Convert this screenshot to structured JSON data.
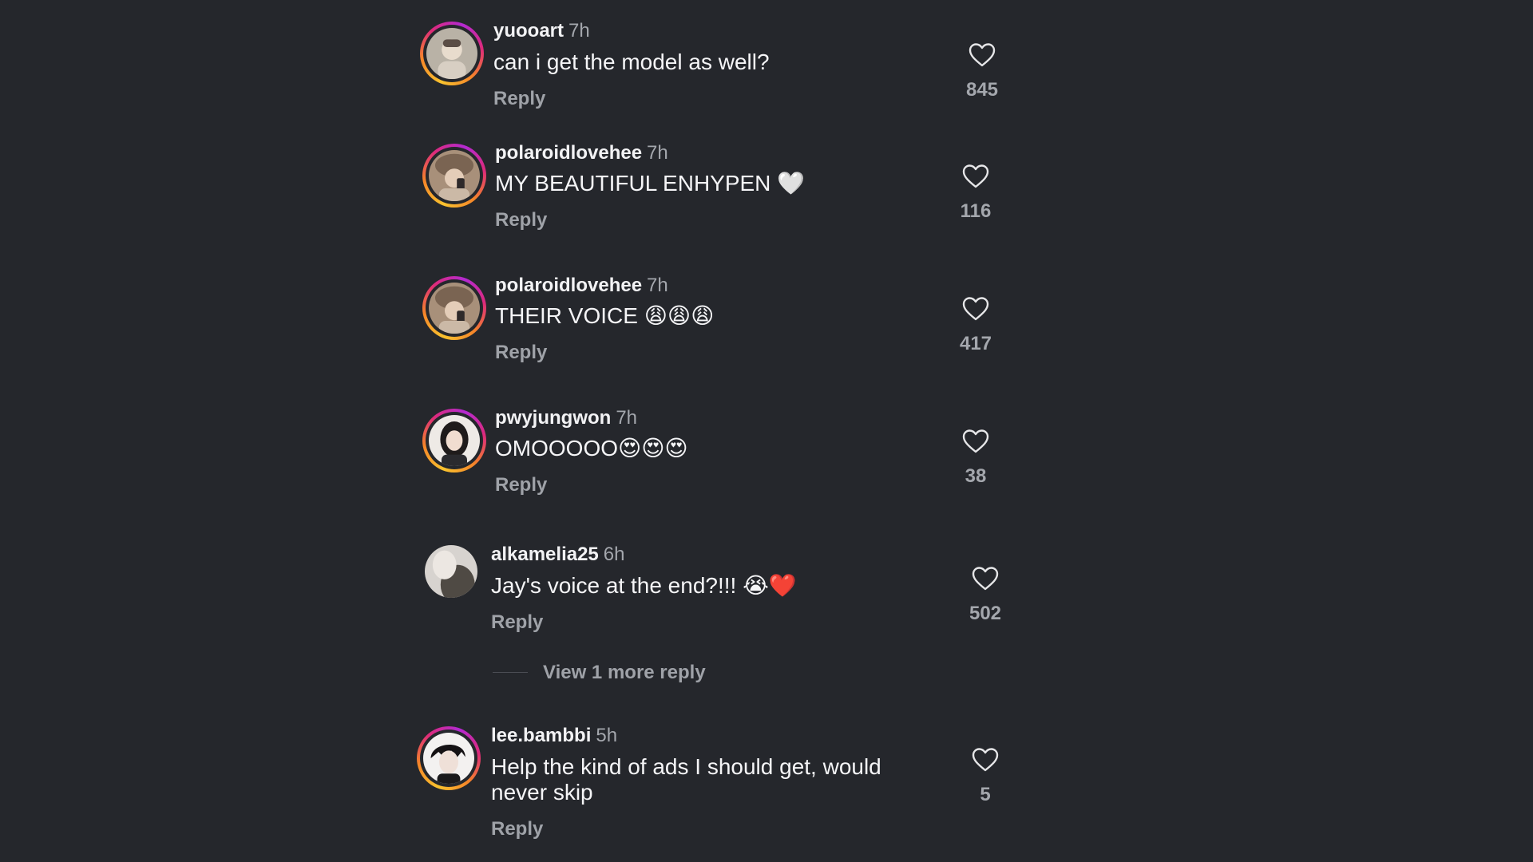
{
  "comments": [
    {
      "username": "yuooart",
      "time": "7h",
      "text": "can i get the model as well?",
      "reply_label": "Reply",
      "likes": "845",
      "avatar_story_ring": true
    },
    {
      "username": "polaroidlovehee",
      "time": "7h",
      "text": "MY BEAUTIFUL ENHYPEN 🤍",
      "reply_label": "Reply",
      "likes": "116",
      "avatar_story_ring": true
    },
    {
      "username": "polaroidlovehee",
      "time": "7h",
      "text": "THEIR VOICE 😩😩😩",
      "reply_label": "Reply",
      "likes": "417",
      "avatar_story_ring": true
    },
    {
      "username": "pwyjungwon",
      "time": "7h",
      "text": "OMOOOOO😍😍😍",
      "reply_label": "Reply",
      "likes": "38",
      "avatar_story_ring": true
    },
    {
      "username": "alkamelia25",
      "time": "6h",
      "text": "Jay's voice at the end?!!! 😭❤️",
      "reply_label": "Reply",
      "likes": "502",
      "avatar_story_ring": false,
      "view_replies_label": "View 1 more reply"
    },
    {
      "username": "lee.bambbi",
      "time": "5h",
      "text": "Help the kind of ads I should get, would never skip",
      "reply_label": "Reply",
      "likes": "5",
      "avatar_story_ring": true
    }
  ],
  "icons": {
    "like": "heart-outline-icon"
  },
  "colors": {
    "background": "#25272c",
    "text_primary": "#f2f2f4",
    "text_secondary": "#a4a7ad",
    "story_ring_start": "#f9c22e",
    "story_ring_end": "#dd2a7b"
  }
}
